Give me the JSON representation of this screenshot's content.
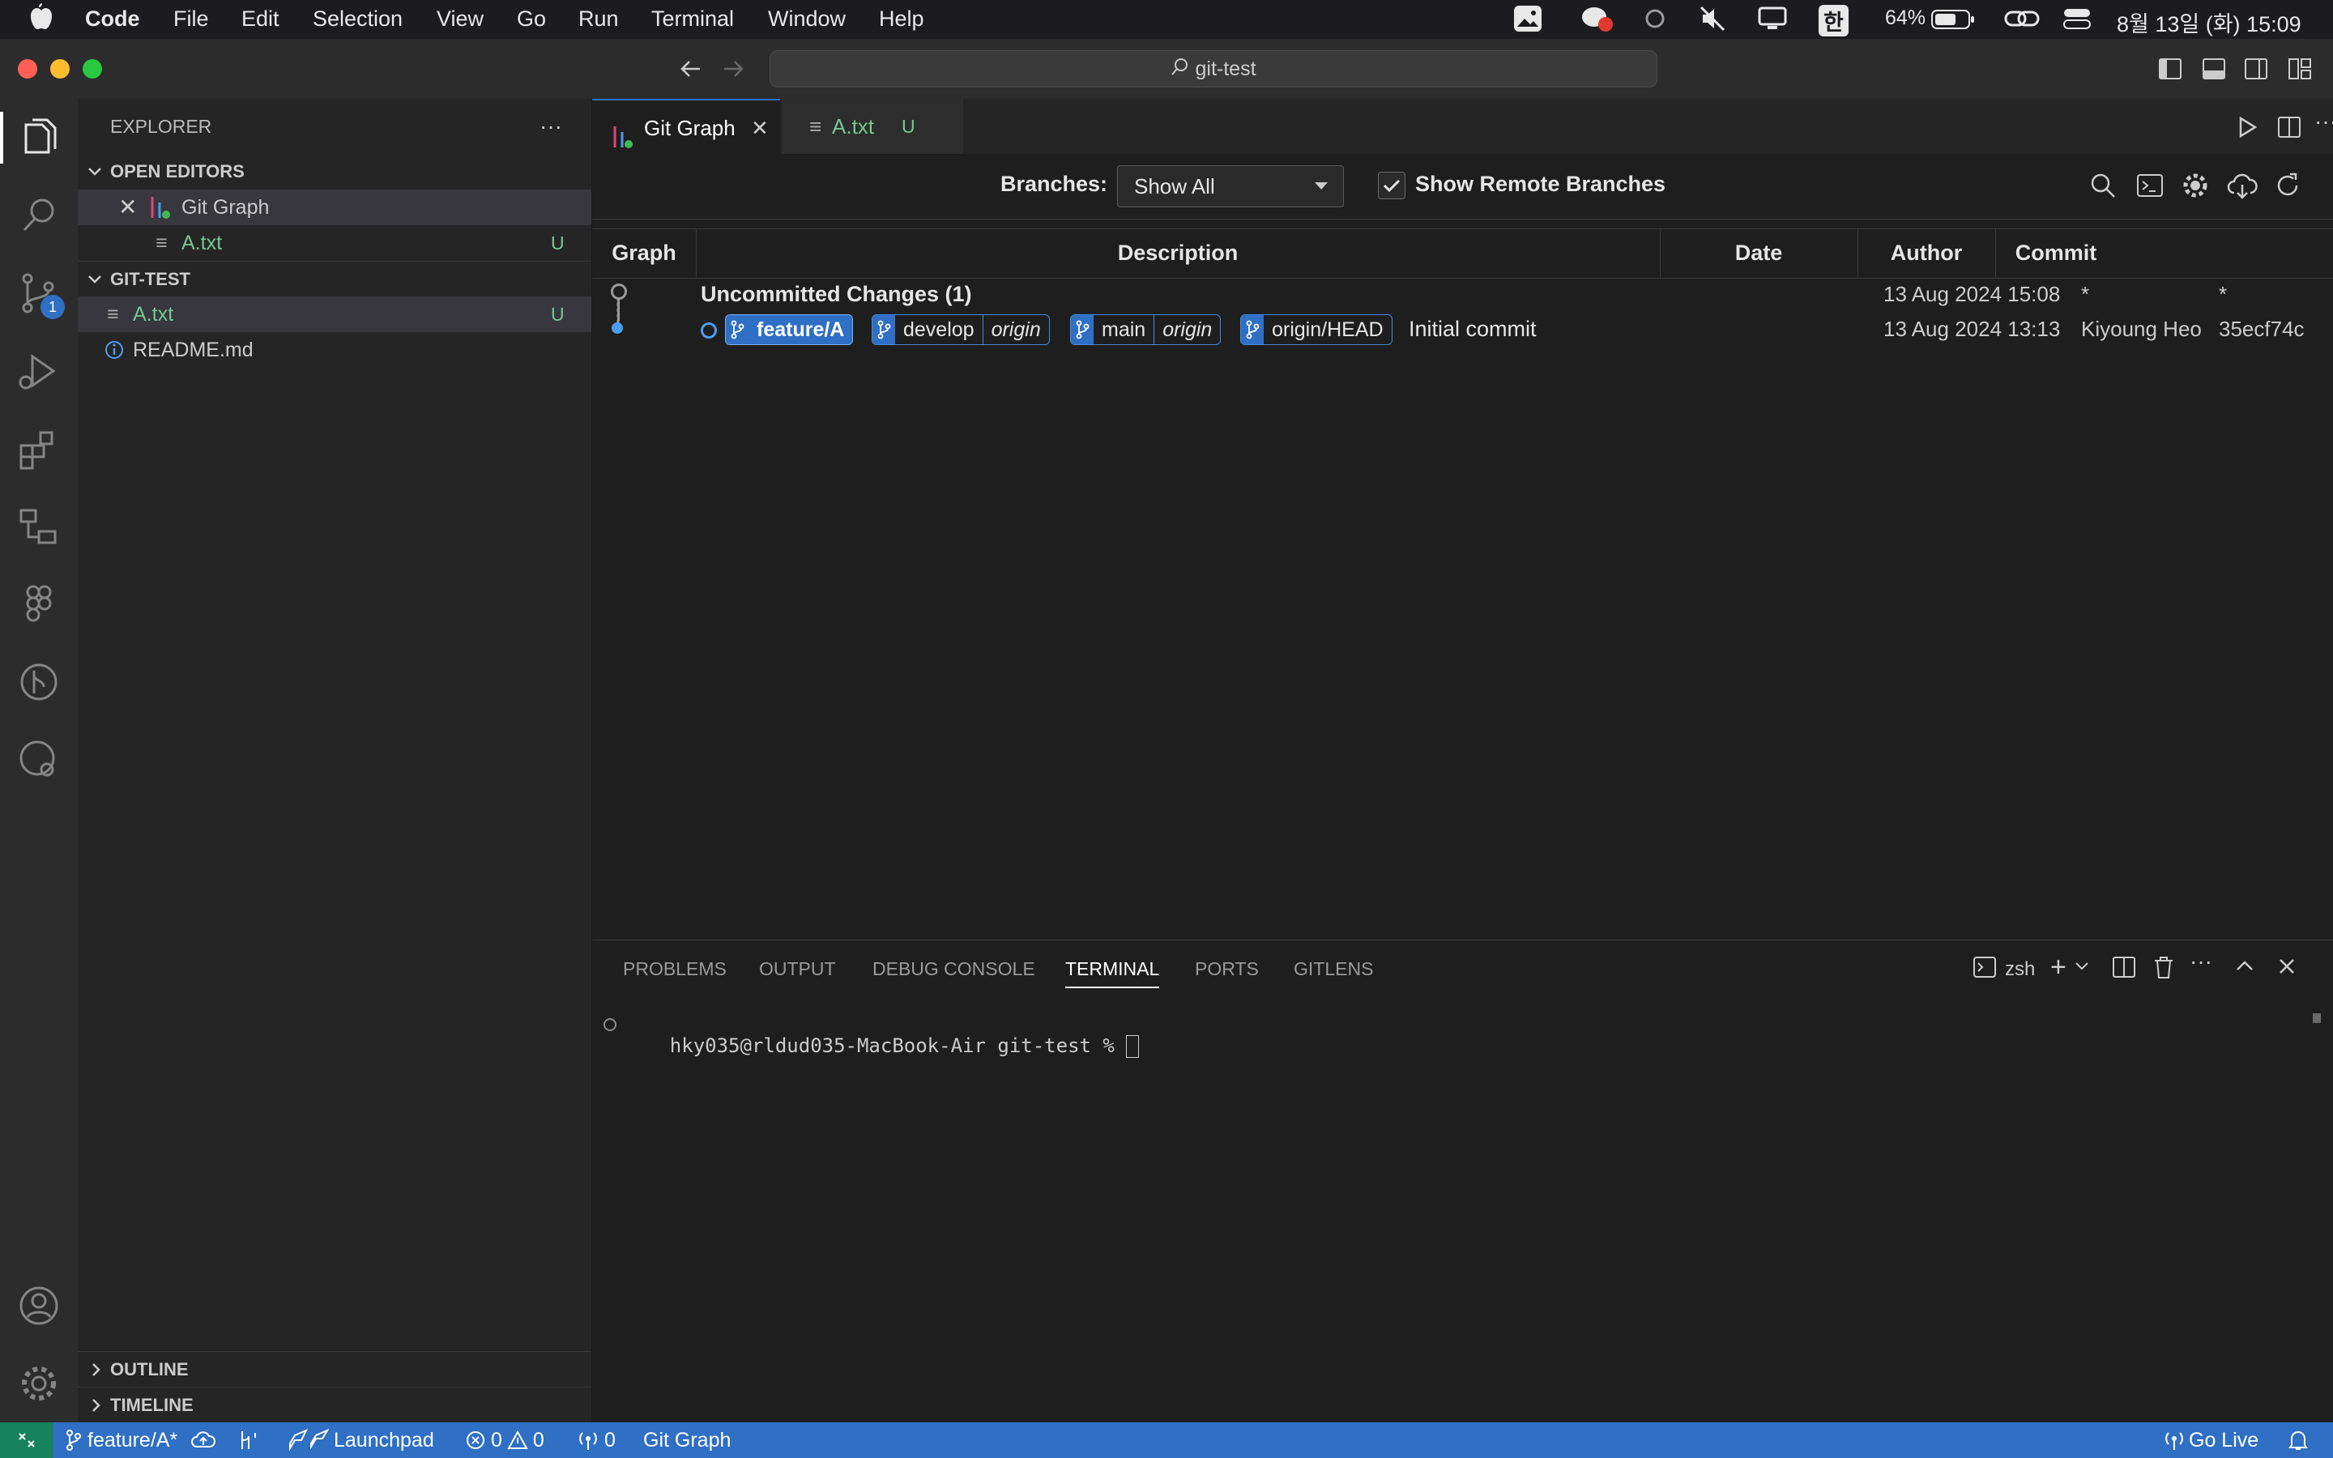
{
  "menubar": {
    "app": "Code",
    "items": [
      "File",
      "Edit",
      "Selection",
      "View",
      "Go",
      "Run",
      "Terminal",
      "Window",
      "Help"
    ],
    "input_source": "한",
    "battery": "64%",
    "clock": "8월 13일 (화) 15:09"
  },
  "titlebar": {
    "search": "git-test"
  },
  "activity": {
    "scm_badge": "1"
  },
  "sidebar": {
    "title": "EXPLORER",
    "open_editors_label": "OPEN EDITORS",
    "open_editors": [
      {
        "name": "Git Graph",
        "status": ""
      },
      {
        "name": "A.txt",
        "status": "U"
      }
    ],
    "folder_label": "GIT-TEST",
    "files": [
      {
        "name": "A.txt",
        "status": "U"
      },
      {
        "name": "README.md",
        "status": ""
      }
    ],
    "outline_label": "OUTLINE",
    "timeline_label": "TIMELINE"
  },
  "tabs": [
    {
      "label": "Git Graph",
      "status": ""
    },
    {
      "label": "A.txt",
      "status": "U"
    }
  ],
  "gitgraph": {
    "branches_label": "Branches:",
    "branches_value": "Show All",
    "remote_label": "Show Remote Branches",
    "columns": [
      "Graph",
      "Description",
      "Date",
      "Author",
      "Commit"
    ],
    "uncommitted": {
      "description": "Uncommitted Changes (1)",
      "date": "13 Aug 2024 15:08",
      "author": "*",
      "commit": "*"
    },
    "commit": {
      "refs": [
        {
          "name": "feature/A",
          "remote": ""
        },
        {
          "name": "develop",
          "remote": "origin"
        },
        {
          "name": "main",
          "remote": "origin"
        },
        {
          "name": "origin/HEAD",
          "remote": ""
        }
      ],
      "message": "Initial commit",
      "date": "13 Aug 2024 13:13",
      "author": "Kiyoung Heo",
      "hash": "35ecf74c"
    },
    "colors": {
      "branch_blue": "#2f6fc4",
      "graph_blue": "#4a9df0",
      "graph_gray": "#9a9a9a"
    }
  },
  "panel": {
    "tabs": [
      "PROBLEMS",
      "OUTPUT",
      "DEBUG CONSOLE",
      "TERMINAL",
      "PORTS",
      "GITLENS"
    ],
    "active_tab": "TERMINAL",
    "shell": "zsh",
    "prompt": "hky035@rldud035-MacBook-Air git-test % "
  },
  "status": {
    "branch": "feature/A*",
    "launchpad": "Launchpad",
    "errors": "0",
    "warnings": "0",
    "ports": "0",
    "git_graph": "Git Graph",
    "go_live": "Go Live"
  }
}
